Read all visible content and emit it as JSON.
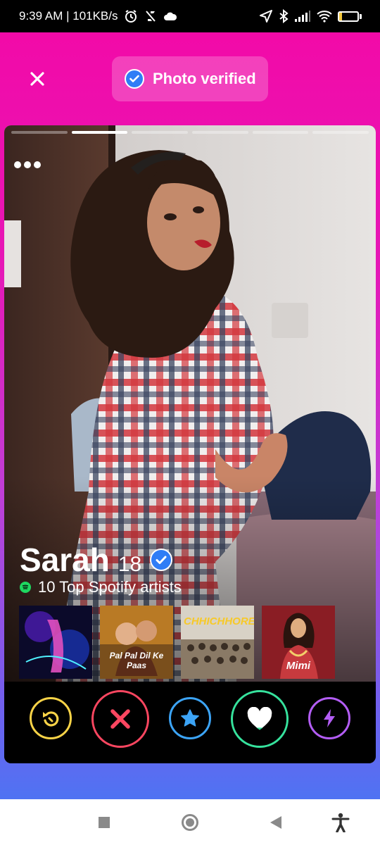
{
  "status_bar": {
    "time_speed": "9:39 AM | 101KB/s",
    "battery_level": "15",
    "icons": [
      "alarm-icon",
      "data-saver-icon",
      "cloud-icon",
      "location-icon",
      "bluetooth-icon",
      "signal-icon",
      "wifi-icon",
      "battery-icon"
    ]
  },
  "header": {
    "close_icon": "close-icon",
    "verified_label": "Photo verified"
  },
  "profile": {
    "name": "Sarah",
    "age": "18",
    "spotify_label": "10 Top Spotify artists",
    "photo_count": 6,
    "active_photo": 2,
    "albums": [
      {
        "label": "",
        "colors": [
          "#0b0a2a",
          "#5b1fa8"
        ]
      },
      {
        "label": "Pal Pal Dil Ke Paas",
        "colors": [
          "#b97a25",
          "#3b2414"
        ]
      },
      {
        "label": "CHHICHHORE",
        "colors": [
          "#d8d2c6",
          "#5a4a3a"
        ]
      },
      {
        "label": "Mimi",
        "colors": [
          "#8a1d24",
          "#d9a06a"
        ]
      }
    ]
  },
  "actions": [
    {
      "name": "rewind-button",
      "icon": "rewind-icon",
      "color": "#f8d347"
    },
    {
      "name": "nope-button",
      "icon": "x-icon",
      "color": "#fc4660"
    },
    {
      "name": "super-like-button",
      "icon": "star-icon",
      "color": "#3ca4f6"
    },
    {
      "name": "like-button",
      "icon": "heart-icon",
      "color": "#36e29d"
    },
    {
      "name": "boost-button",
      "icon": "lightning-icon",
      "color": "#b35df5"
    }
  ],
  "nav": {
    "icons": [
      "recents-icon",
      "home-icon",
      "back-icon",
      "accessibility-icon"
    ]
  },
  "colors": {
    "brand_gradient_top": "#f20aa8",
    "brand_gradient_bottom": "#4f73f2",
    "verified_blue": "#2f7df6"
  }
}
